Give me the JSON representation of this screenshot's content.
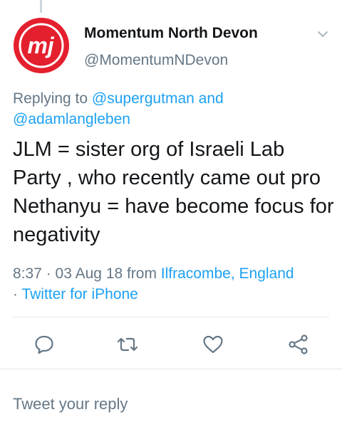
{
  "tweet": {
    "author_name": "Momentum North Devon",
    "author_handle": "@MomentumNDevon",
    "replying_to_prefix": "Replying to ",
    "replying_to_mention_1": "@supergutman",
    "replying_to_and": " and",
    "replying_to_mention_2": "@adamlangleben",
    "text": "JLM = sister org of Israeli Lab Party , who recently came out pro Nethanyu = have become focus for negativity",
    "timestamp": "8:37 · 03 Aug 18 from ",
    "location": "Ilfracombe, England",
    "source_separator": "· ",
    "source": "Twitter for iPhone"
  },
  "avatar": {
    "logo_text": "mj",
    "brand_color": "#e4202e"
  },
  "actions": [
    {
      "name": "reply",
      "icon": "comment-icon"
    },
    {
      "name": "retweet",
      "icon": "retweet-icon"
    },
    {
      "name": "like",
      "icon": "heart-icon"
    },
    {
      "name": "share",
      "icon": "share-icon"
    }
  ],
  "composer": {
    "placeholder": "Tweet your reply"
  },
  "colors": {
    "link": "#1da1f2",
    "secondary_text": "#657786",
    "primary_text": "#14171a",
    "divider": "#e1e8ed"
  }
}
